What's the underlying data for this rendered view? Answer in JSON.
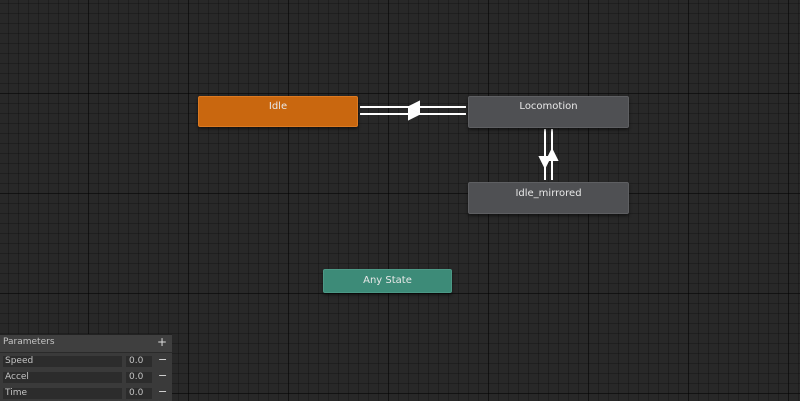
{
  "states": {
    "idle": "Idle",
    "locomotion": "Locomotion",
    "idle_mirrored": "Idle_mirrored",
    "any_state": "Any State"
  },
  "colors": {
    "default_state": "#c9670f",
    "state": "#4f5053",
    "any_state": "#3d8b78",
    "grid_background": "#282828",
    "transition": "#ffffff"
  },
  "parameters": {
    "title": "Parameters",
    "add_icon": "+",
    "items": [
      {
        "name": "Speed",
        "value": "0.0",
        "remove_icon": "−"
      },
      {
        "name": "Accel",
        "value": "0.0",
        "remove_icon": "−"
      },
      {
        "name": "Time",
        "value": "0.0",
        "remove_icon": "−"
      }
    ]
  }
}
